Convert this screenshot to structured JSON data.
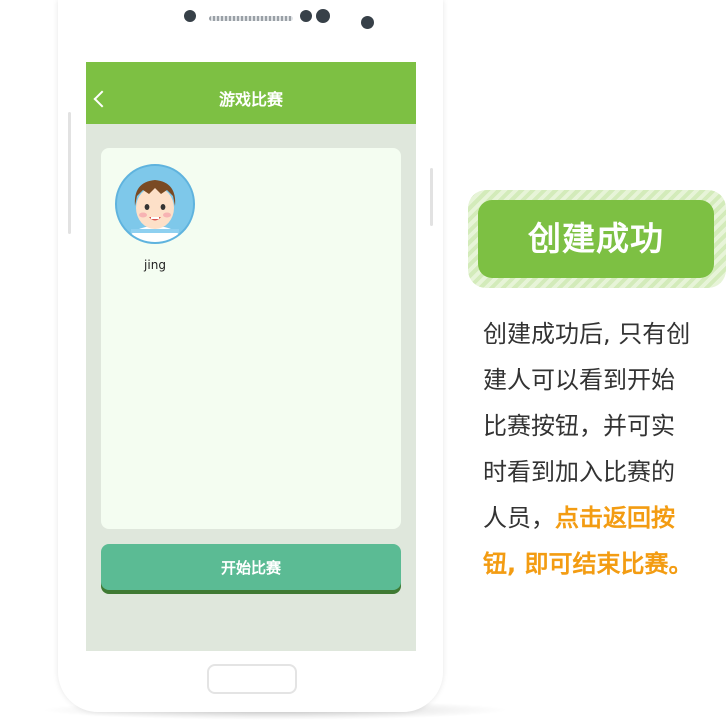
{
  "screen": {
    "title": "游戏比赛",
    "player": {
      "name": "jing"
    },
    "start_button_label": "开始比赛"
  },
  "badge": {
    "label": "创建成功"
  },
  "description": {
    "line1": "创建成功后, 只有创",
    "line2": "建人可以看到开始",
    "line3": "比赛按钮，并可实",
    "line4": "时看到加入比赛的",
    "line5_normal": "人员，",
    "line5_highlight": "点击返回按",
    "line6_highlight": "钮, 即可结束比赛。"
  },
  "colors": {
    "accent_green": "#7dc043",
    "button_teal": "#5bbb94",
    "highlight_orange": "#f39c12"
  },
  "icons": [
    "back-icon",
    "avatar-image"
  ]
}
